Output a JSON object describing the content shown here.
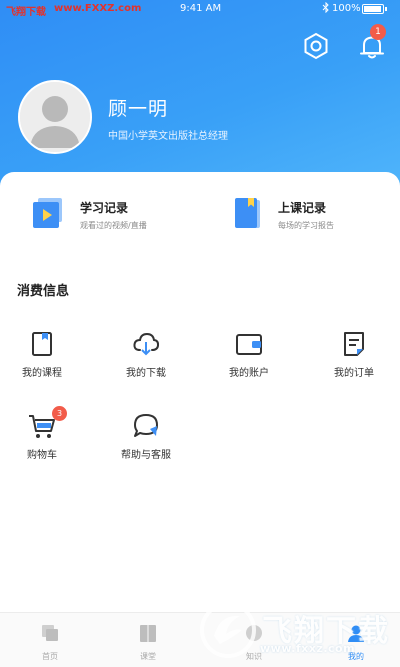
{
  "status_bar": {
    "site_label": "飞翔下载",
    "site_url": "www.FXXZ.com",
    "time": "9:41 AM",
    "battery": "100%"
  },
  "header": {
    "notification_count": "1",
    "user_name": "顾一明",
    "user_title": "中国小学英文出版社总经理",
    "icons": {
      "settings": "hexagon-settings-icon",
      "notifications": "bell-icon"
    }
  },
  "records": [
    {
      "title": "学习记录",
      "subtitle": "观看过的视频/直播",
      "icon": "video-record-icon",
      "color": "#3d8ff5"
    },
    {
      "title": "上课记录",
      "subtitle": "每场的学习报告",
      "icon": "book-record-icon",
      "color": "#3d8ff5"
    }
  ],
  "consumption": {
    "title": "消费信息",
    "items": [
      {
        "label": "我的课程",
        "icon": "course-icon"
      },
      {
        "label": "我的下载",
        "icon": "cloud-download-icon"
      },
      {
        "label": "我的账户",
        "icon": "wallet-icon"
      },
      {
        "label": "我的订单",
        "icon": "order-icon"
      },
      {
        "label": "购物车",
        "icon": "cart-icon",
        "badge": "3"
      },
      {
        "label": "帮助与客服",
        "icon": "help-chat-icon"
      }
    ]
  },
  "tabbar": {
    "tabs": [
      {
        "label": "首页",
        "active": false
      },
      {
        "label": "课堂",
        "active": false
      },
      {
        "label": "知识",
        "active": false
      },
      {
        "label": "我的",
        "active": true
      }
    ]
  },
  "watermark": {
    "text": "飞翔下载",
    "url": "www.fxxz.com"
  },
  "colors": {
    "primary": "#2f8df5",
    "badge": "#f25c4a"
  }
}
